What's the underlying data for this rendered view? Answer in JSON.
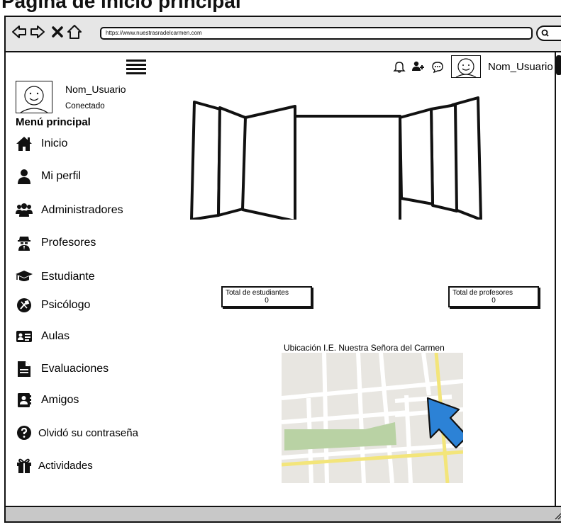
{
  "page_heading": "Página de inicio principal",
  "browser": {
    "url": "https://www.nuestrasradelcarmen.com",
    "back_icon": "arrow-left-icon",
    "forward_icon": "arrow-right-icon",
    "close_icon": "close-icon",
    "home_icon": "home-icon",
    "search_icon": "search-icon"
  },
  "header": {
    "menu_icon": "hamburger-menu-icon",
    "notification_icon": "bell-icon",
    "add_user_icon": "add-user-icon",
    "chat_icon": "chat-icon",
    "username": "Nom_Usuario"
  },
  "sidebar": {
    "username": "Nom_Usuario",
    "status": "Conectado",
    "menu_heading": "Menú principal",
    "items": [
      {
        "label": "Inicio",
        "icon": "home-icon"
      },
      {
        "label": "Mi perfil",
        "icon": "user-icon"
      },
      {
        "label": "Administradores",
        "icon": "users-icon"
      },
      {
        "label": "Profesores",
        "icon": "user-secret-icon"
      },
      {
        "label": "Estudiante",
        "icon": "graduation-cap-icon"
      },
      {
        "label": "Psicólogo",
        "icon": "tools-icon"
      },
      {
        "label": "Aulas",
        "icon": "id-card-icon"
      },
      {
        "label": "Evaluaciones",
        "icon": "document-icon"
      },
      {
        "label": "Amigos",
        "icon": "contact-book-icon"
      },
      {
        "label": "Olvidó su contraseña",
        "icon": "question-circle-icon"
      },
      {
        "label": "Actividades",
        "icon": "gift-icon"
      }
    ]
  },
  "stats": {
    "students_label": "Total de estudiantes",
    "students_value": "0",
    "teachers_label": "Total de profesores",
    "teachers_value": "0"
  },
  "map": {
    "title": "Ubicación I.E. Nuestra Señora del Carmen",
    "road_color": "#f3e57a",
    "park_color": "#b9d2a4",
    "block_color": "#e8e6e1",
    "pointer_color": "#2c82d6"
  }
}
